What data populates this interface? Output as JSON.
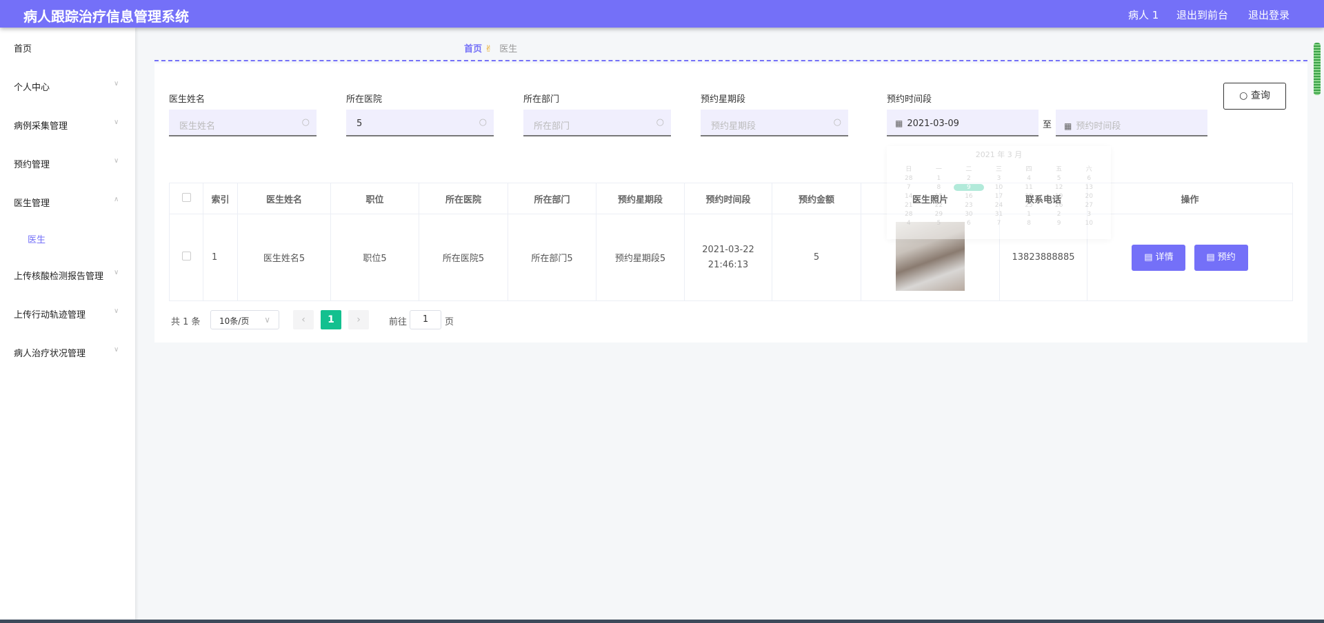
{
  "header": {
    "title": "病人跟踪治疗信息管理系统",
    "user": "病人 1",
    "to_front": "退出到前台",
    "logout": "退出登录"
  },
  "sidebar": {
    "items": [
      {
        "label": "首页"
      },
      {
        "label": "个人中心"
      },
      {
        "label": "病例采集管理"
      },
      {
        "label": "预约管理"
      },
      {
        "label": "医生管理"
      },
      {
        "label": "医生"
      },
      {
        "label": "上传核酸检测报告管理"
      },
      {
        "label": "上传行动轨迹管理"
      },
      {
        "label": "病人治疗状况管理"
      }
    ]
  },
  "breadcrumb": {
    "home": "首页",
    "current": "医生"
  },
  "filters": {
    "name": {
      "label": "医生姓名",
      "placeholder": "医生姓名",
      "value": ""
    },
    "hospital": {
      "label": "所在医院",
      "value": "5"
    },
    "dept": {
      "label": "所在部门",
      "placeholder": "所在部门"
    },
    "weekday": {
      "label": "预约星期段",
      "placeholder": "预约星期段"
    },
    "time": {
      "label": "预约时间段",
      "start": "2021-03-09",
      "sep": "至",
      "end_placeholder": "预约时间段"
    },
    "query": "查询"
  },
  "calendar": {
    "title": "2021 年 3 月",
    "weekdays": [
      "日",
      "一",
      "二",
      "三",
      "四",
      "五",
      "六"
    ],
    "days": [
      "28",
      "1",
      "2",
      "3",
      "4",
      "5",
      "6",
      "7",
      "8",
      "9",
      "10",
      "11",
      "12",
      "13",
      "14",
      "15",
      "16",
      "17",
      "18",
      "19",
      "20",
      "21",
      "22",
      "23",
      "24",
      "25",
      "26",
      "27",
      "28",
      "29",
      "30",
      "31",
      "1",
      "2",
      "3",
      "4",
      "5",
      "6",
      "7",
      "8",
      "9",
      "10"
    ],
    "selected": "9"
  },
  "table": {
    "headers": [
      "索引",
      "医生姓名",
      "职位",
      "所在医院",
      "所在部门",
      "预约星期段",
      "预约时间段",
      "预约金额",
      "医生照片",
      "联系电话",
      "操作"
    ],
    "rows": [
      {
        "index": "1",
        "name": "医生姓名5",
        "title": "职位5",
        "hospital": "所在医院5",
        "dept": "所在部门5",
        "weekday": "预约星期段5",
        "time": "2021-03-22 21:46:13",
        "fee": "5",
        "phone": "13823888885",
        "detail": "详情",
        "book": "预约"
      }
    ]
  },
  "pagination": {
    "total": "共 1 条",
    "page_size": "10条/页",
    "current": "1",
    "goto": "前往",
    "goto_value": "1",
    "page_unit": "页"
  }
}
